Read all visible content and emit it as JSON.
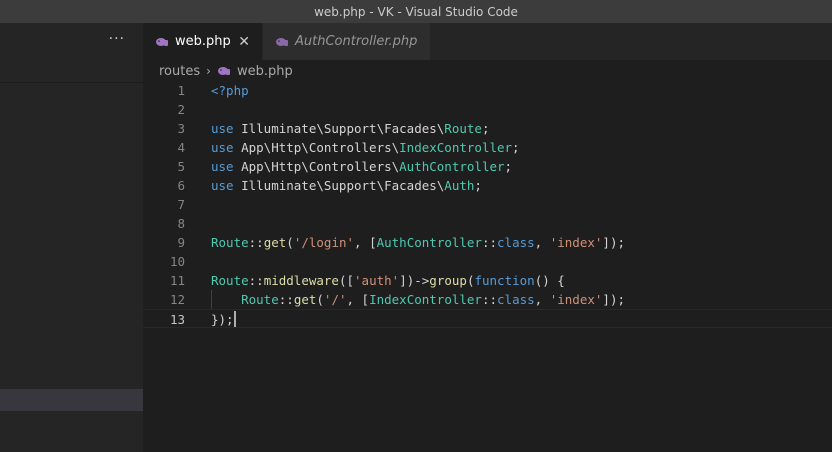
{
  "window": {
    "title": "web.php - VK - Visual Studio Code"
  },
  "sidebar": {
    "more_label": "···"
  },
  "tabs": [
    {
      "label": "web.php",
      "active": true,
      "close": "✕"
    },
    {
      "label": "AuthController.php",
      "active": false
    }
  ],
  "breadcrumb": {
    "folder": "routes",
    "separator": "›",
    "file": "web.php"
  },
  "editor": {
    "current_line": 13,
    "lines": [
      {
        "n": "1",
        "t": [
          [
            "tag",
            "<?php"
          ]
        ]
      },
      {
        "n": "2",
        "t": []
      },
      {
        "n": "3",
        "t": [
          [
            "kw",
            "use"
          ],
          [
            "pun",
            " Illuminate\\Support\\Facades\\"
          ],
          [
            "cls",
            "Route"
          ],
          [
            "pun",
            ";"
          ]
        ]
      },
      {
        "n": "4",
        "t": [
          [
            "kw",
            "use"
          ],
          [
            "pun",
            " App\\Http\\Controllers\\"
          ],
          [
            "cls",
            "IndexController"
          ],
          [
            "pun",
            ";"
          ]
        ]
      },
      {
        "n": "5",
        "t": [
          [
            "kw",
            "use"
          ],
          [
            "pun",
            " App\\Http\\Controllers\\"
          ],
          [
            "cls",
            "AuthController"
          ],
          [
            "pun",
            ";"
          ]
        ]
      },
      {
        "n": "6",
        "t": [
          [
            "kw",
            "use"
          ],
          [
            "pun",
            " Illuminate\\Support\\Facades\\"
          ],
          [
            "cls",
            "Auth"
          ],
          [
            "pun",
            ";"
          ]
        ]
      },
      {
        "n": "7",
        "t": []
      },
      {
        "n": "8",
        "t": []
      },
      {
        "n": "9",
        "t": [
          [
            "cls",
            "Route"
          ],
          [
            "pun",
            "::"
          ],
          [
            "fn",
            "get"
          ],
          [
            "pun",
            "("
          ],
          [
            "str",
            "'/login'"
          ],
          [
            "pun",
            ", ["
          ],
          [
            "cls",
            "AuthController"
          ],
          [
            "pun",
            "::"
          ],
          [
            "kw",
            "class"
          ],
          [
            "pun",
            ", "
          ],
          [
            "str",
            "'index'"
          ],
          [
            "pun",
            "]);"
          ]
        ]
      },
      {
        "n": "10",
        "t": []
      },
      {
        "n": "11",
        "t": [
          [
            "cls",
            "Route"
          ],
          [
            "pun",
            "::"
          ],
          [
            "fn",
            "middleware"
          ],
          [
            "pun",
            "(["
          ],
          [
            "str",
            "'auth'"
          ],
          [
            "pun",
            "])->"
          ],
          [
            "fn",
            "group"
          ],
          [
            "pun",
            "("
          ],
          [
            "kw",
            "function"
          ],
          [
            "pun",
            "() {"
          ]
        ]
      },
      {
        "n": "12",
        "t": [
          [
            "pun",
            "    "
          ],
          [
            "cls",
            "Route"
          ],
          [
            "pun",
            "::"
          ],
          [
            "fn",
            "get"
          ],
          [
            "pun",
            "("
          ],
          [
            "str",
            "'/'"
          ],
          [
            "pun",
            ", ["
          ],
          [
            "cls",
            "IndexController"
          ],
          [
            "pun",
            "::"
          ],
          [
            "kw",
            "class"
          ],
          [
            "pun",
            ", "
          ],
          [
            "str",
            "'index'"
          ],
          [
            "pun",
            "]);"
          ]
        ],
        "guide": true
      },
      {
        "n": "13",
        "t": [
          [
            "pun",
            "});"
          ]
        ],
        "cursor": true
      }
    ]
  }
}
